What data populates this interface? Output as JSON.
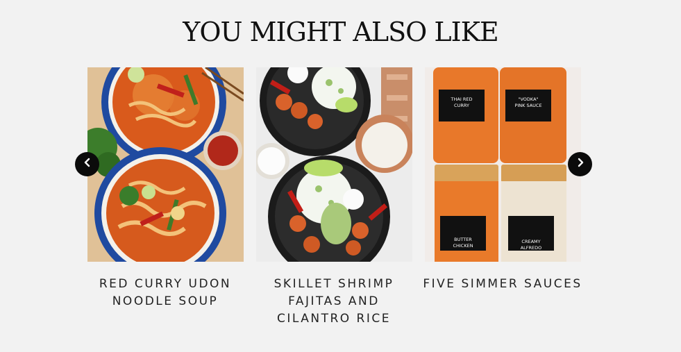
{
  "section": {
    "title": "YOU MIGHT ALSO LIKE"
  },
  "carousel": {
    "prev_icon": "chevron-left-icon",
    "next_icon": "chevron-right-icon",
    "items": [
      {
        "title": "RED CURRY UDON NOODLE SOUP",
        "image": "red-curry-udon-photo"
      },
      {
        "title": "SKILLET SHRIMP FAJITAS AND CILANTRO RICE",
        "image": "shrimp-fajitas-photo"
      },
      {
        "title": "FIVE SIMMER SAUCES",
        "image": "simmer-sauces-photo",
        "jar_labels": [
          "THAI RED CURRY",
          "\"VODKA\" PINK SAUCE",
          "BUTTER CHICKEN",
          "CREAMY ALFREDO"
        ]
      }
    ]
  },
  "colors": {
    "background": "#f2f2f2",
    "arrow_bg": "#0b0b0b",
    "title_text": "#111111"
  }
}
